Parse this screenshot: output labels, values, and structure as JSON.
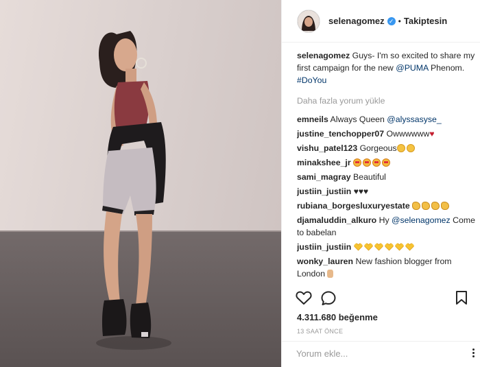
{
  "header": {
    "username": "selenagomez",
    "verified_mark": "✓",
    "separator": "•",
    "follow_label": "Takiptesin"
  },
  "caption": {
    "username": "selenagomez",
    "text": "Guys- I'm so excited to share my first campaign for the new ",
    "mention": "@PUMA",
    "text2": " Phenom. ",
    "hashtag": "#DoYou"
  },
  "load_more": "Daha fazla yorum yükle",
  "comments": [
    {
      "user": "emneils",
      "text": "Always Queen ",
      "link": "@alyssasyse_"
    },
    {
      "user": "justine_tenchopper07",
      "text": "Owwwwww"
    },
    {
      "user": "vishu_patel123",
      "text": "Gorgeous"
    },
    {
      "user": "minakshee_jr",
      "text": ""
    },
    {
      "user": "sami_magray",
      "text": "Beautiful"
    },
    {
      "user": "justiin_justiin",
      "text": ""
    },
    {
      "user": "rubiana_borgesluxuryestate",
      "text": ""
    },
    {
      "user": "djamaluddin_alkuro",
      "text": "Hy ",
      "link": "@selenagomez",
      "text2": " Come to babelan"
    },
    {
      "user": "justiin_justiin",
      "text": ""
    },
    {
      "user": "wonky_lauren",
      "text": "New fashion blogger from London "
    }
  ],
  "likes": "4.311.680 beğenme",
  "timestamp": "13 SAAT ÖNCE",
  "add_comment": {
    "placeholder": "Yorum ekle..."
  },
  "colors": {
    "link": "#003569",
    "verified": "#3897f0",
    "muted": "#999999"
  },
  "icons": [
    "heart-icon",
    "comment-icon",
    "bookmark-icon",
    "verified-icon",
    "more-options-icon"
  ]
}
